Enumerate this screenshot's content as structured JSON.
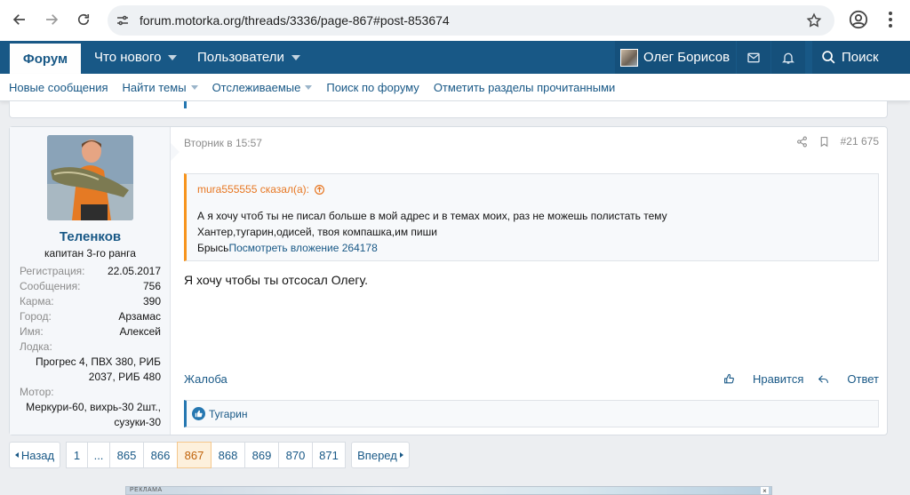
{
  "browser": {
    "url": "forum.motorka.org/threads/3336/page-867#post-853674"
  },
  "topnav": {
    "tabs": [
      {
        "label": "Форум"
      },
      {
        "label": "Что нового"
      },
      {
        "label": "Пользователи"
      }
    ],
    "user_name": "Олег Борисов",
    "search_label": "Поиск"
  },
  "subnav": {
    "items": [
      {
        "label": "Новые сообщения"
      },
      {
        "label": "Найти темы"
      },
      {
        "label": "Отслеживаемые"
      },
      {
        "label": "Поиск по форуму"
      },
      {
        "label": "Отметить разделы прочитанными"
      }
    ]
  },
  "post": {
    "author": {
      "name": "Теленков",
      "title": "капитан 3-го ранга",
      "stats": [
        {
          "key": "Регистрация:",
          "value": "22.05.2017"
        },
        {
          "key": "Сообщения:",
          "value": "756"
        },
        {
          "key": "Карма:",
          "value": "390"
        },
        {
          "key": "Город:",
          "value": "Арзамас"
        },
        {
          "key": "Имя:",
          "value": "Алексей"
        }
      ],
      "boat_key": "Лодка:",
      "boat_value_1": "Прогрес 4, ПВХ 380, РИБ",
      "boat_value_2": "2037, РИБ 480",
      "motor_key": "Мотор:",
      "motor_value_1": "Меркури-60, вихрь-30 2шт.,",
      "motor_value_2": "сузуки-30"
    },
    "date": "Вторник в 15:57",
    "number": "#21 675",
    "quote": {
      "header": "mura555555 сказал(а):",
      "line1": "А я хочу чтоб ты не писал больше в мой адрес и в темах моих, раз не можешь полистать тему",
      "line2": "Хантер,тугарин,одисей, твоя компашка,им пиши",
      "line3_prefix": "Брысь",
      "line3_link": "Посмотреть вложение 264178"
    },
    "message": "Я хочу чтобы ты отсосал Олегу.",
    "actions": {
      "report": "Жалоба",
      "like": "Нравится",
      "reply": "Ответ"
    },
    "reactions": {
      "user": "Тугарин"
    }
  },
  "pagination": {
    "prev": "Назад",
    "next": "Вперед",
    "pages": [
      "1",
      "...",
      "865",
      "866",
      "867",
      "868",
      "869",
      "870",
      "871"
    ],
    "current": "867"
  },
  "ad": {
    "label": "РЕКЛАМА",
    "close": "×"
  },
  "colors": {
    "nav_bg": "#185886",
    "link": "#185886",
    "quote_accent": "#f7941d",
    "reaction_accent": "#2577b1"
  }
}
